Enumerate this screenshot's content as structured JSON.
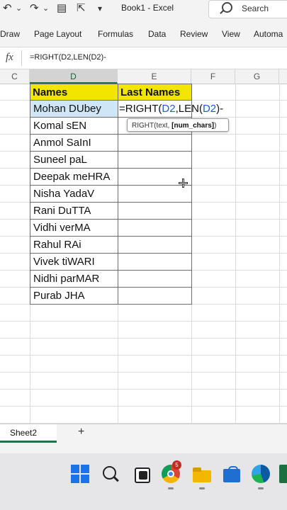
{
  "title_bar": {
    "title": "Book1 - Excel",
    "search_label": "Search",
    "quick_access": {
      "undo_glyph": "↶",
      "redo_glyph": "↷",
      "dropdown_glyph": "⌄",
      "form_glyph": "▤",
      "customize_glyph": "▾"
    }
  },
  "ribbon": {
    "tabs": [
      "Draw",
      "Page Layout",
      "Formulas",
      "Data",
      "Review",
      "View",
      "Automa"
    ]
  },
  "formula_bar": {
    "fx_label": "fx",
    "value": "=RIGHT(D2,LEN(D2)-"
  },
  "columns": [
    "C",
    "D",
    "E",
    "F",
    "G"
  ],
  "selected_column": "D",
  "sheet": {
    "header_names": "Names",
    "header_last_names": "Last Names",
    "names": [
      "Mohan DUbey",
      "Komal sEN",
      "Anmol SaInI",
      "Suneel paL",
      "Deepak meHRA",
      "Nisha YadaV",
      "Rani DuTTA",
      "Vidhi verMA",
      "Rahul RAi",
      "Vivek tiWARI",
      "Nidhi parMAR",
      "Purab JHA"
    ],
    "editing": {
      "prefix": "=RIGHT(",
      "ref1": "D2",
      "mid": ",LEN(",
      "ref2": "D2",
      "suffix": ")-"
    }
  },
  "tooltip": {
    "prefix": "RIGHT(text, ",
    "bold": "[num_chars]",
    "suffix": ")"
  },
  "sheet_tabs": {
    "active": "Sheet2",
    "add_glyph": "+"
  },
  "taskbar": {
    "chrome_badge": "5",
    "icons": [
      "windows-icon",
      "search-icon",
      "task-view-icon",
      "chrome-icon",
      "file-explorer-icon",
      "store-icon",
      "edge-icon",
      "excel-icon"
    ]
  },
  "colors": {
    "header_fill": "#f2e600",
    "excel_green": "#217346",
    "active_cell": "#cfe6f7"
  }
}
